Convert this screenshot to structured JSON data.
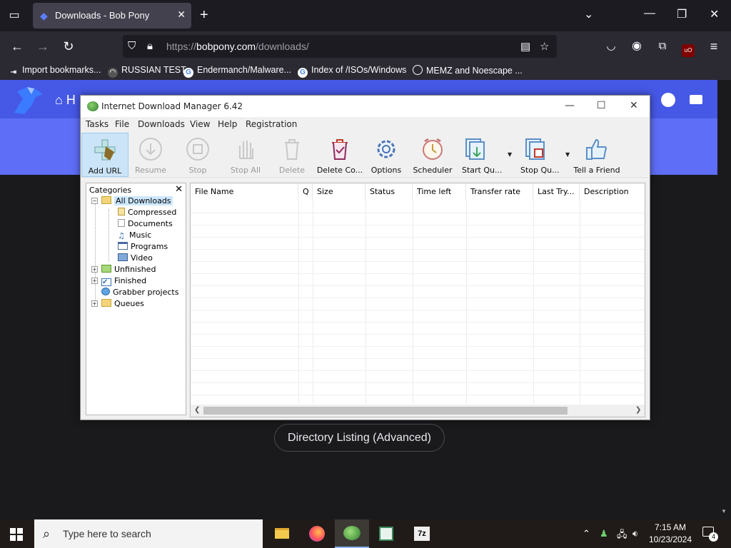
{
  "browser": {
    "tab_title": "Downloads - Bob Pony",
    "url_prefix": "https://",
    "url_host": "bobpony.com",
    "url_path": "/downloads/",
    "bookmarks": [
      {
        "label": "Import bookmarks...",
        "icon": "import-icon"
      },
      {
        "label": "RUSSIAN TEST",
        "icon": "hat-icon"
      },
      {
        "label": "Endermanch/Malware...",
        "icon": "google-icon"
      },
      {
        "label": "Index of /ISOs/Windows",
        "icon": "google-icon"
      },
      {
        "label": "MEMZ and Noescape ...",
        "icon": "globe-icon"
      }
    ],
    "ublock_badge": "uO"
  },
  "page": {
    "home_label": "H",
    "directory_listing_button": "Directory Listing (Advanced)"
  },
  "idm": {
    "title": "Internet Download Manager 6.42",
    "menu": [
      "Tasks",
      "File",
      "Downloads",
      "View",
      "Help",
      "Registration"
    ],
    "toolbar": [
      {
        "label": "Add URL",
        "icon": "add-url-icon",
        "enabled": true
      },
      {
        "label": "Resume",
        "icon": "resume-icon",
        "enabled": false
      },
      {
        "label": "Stop",
        "icon": "stop-icon",
        "enabled": false
      },
      {
        "label": "Stop All",
        "icon": "stop-all-icon",
        "enabled": false
      },
      {
        "label": "Delete",
        "icon": "delete-icon",
        "enabled": false
      },
      {
        "label": "Delete Co...",
        "icon": "delete-completed-icon",
        "enabled": true
      },
      {
        "label": "Options",
        "icon": "options-gear-icon",
        "enabled": true
      },
      {
        "label": "Scheduler",
        "icon": "scheduler-clock-icon",
        "enabled": true
      },
      {
        "label": "Start Qu...",
        "icon": "start-queue-icon",
        "enabled": true
      },
      {
        "label": "Stop Qu...",
        "icon": "stop-queue-icon",
        "enabled": true
      },
      {
        "label": "Tell a Friend",
        "icon": "thumbs-up-icon",
        "enabled": true
      }
    ],
    "categories_header": "Categories",
    "tree": [
      {
        "label": "All Downloads",
        "level": 0,
        "expander": "−"
      },
      {
        "label": "Compressed",
        "level": 1
      },
      {
        "label": "Documents",
        "level": 1
      },
      {
        "label": "Music",
        "level": 1
      },
      {
        "label": "Programs",
        "level": 1
      },
      {
        "label": "Video",
        "level": 1
      },
      {
        "label": "Unfinished",
        "level": 0,
        "expander": "+"
      },
      {
        "label": "Finished",
        "level": 0,
        "expander": "+"
      },
      {
        "label": "Grabber projects",
        "level": 0
      },
      {
        "label": "Queues",
        "level": 0,
        "expander": "+"
      }
    ],
    "columns": [
      "File Name",
      "Q",
      "Size",
      "Status",
      "Time left",
      "Transfer rate",
      "Last Try...",
      "Description"
    ]
  },
  "taskbar": {
    "search_placeholder": "Type here to search",
    "time": "7:15 AM",
    "date": "10/23/2024",
    "notification_count": "4",
    "apps": [
      "file-explorer-icon",
      "firefox-icon",
      "idm-icon",
      "notepad-icon",
      "7zip-icon"
    ]
  }
}
